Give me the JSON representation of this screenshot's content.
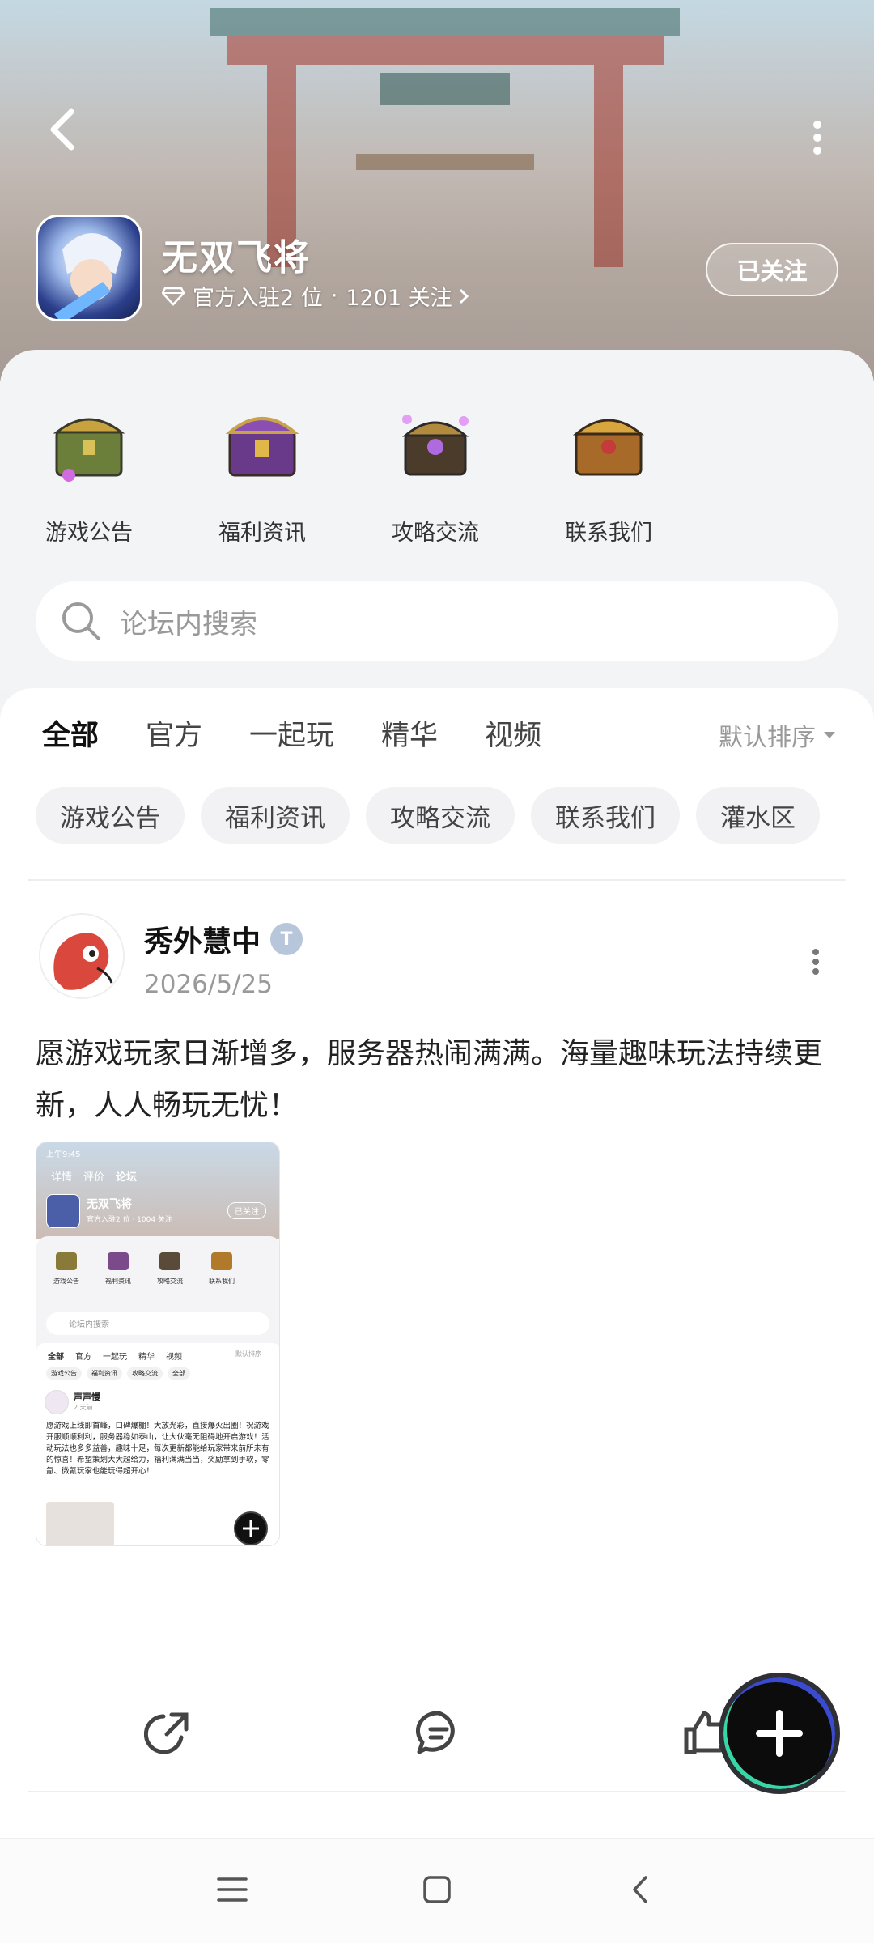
{
  "header": {
    "game_title": "无双飞将",
    "official_text": "官方入驻2 位",
    "separator": "·",
    "followers_text": "1201 关注",
    "follow_label": "已关注"
  },
  "categories": [
    {
      "label": "游戏公告",
      "icon": "green-chest-icon"
    },
    {
      "label": "福利资讯",
      "icon": "purple-chest-icon"
    },
    {
      "label": "攻略交流",
      "icon": "gem-chest-icon"
    },
    {
      "label": "联系我们",
      "icon": "gold-chest-icon"
    }
  ],
  "search": {
    "placeholder": "论坛内搜索"
  },
  "tabs": [
    {
      "label": "全部",
      "active": true
    },
    {
      "label": "官方",
      "active": false
    },
    {
      "label": "一起玩",
      "active": false
    },
    {
      "label": "精华",
      "active": false
    },
    {
      "label": "视频",
      "active": false
    }
  ],
  "sort_label": "默认排序",
  "chips": [
    "游戏公告",
    "福利资讯",
    "攻略交流",
    "联系我们",
    "灌水区"
  ],
  "post": {
    "author": "秀外慧中",
    "date": "2026/5/25",
    "text": "愿游戏玩家日渐增多，服务器热闹满满。海量趣味玩法持续更新，人人畅玩无忧！",
    "thumb": {
      "time": "上午9:45",
      "tabs": [
        "详情",
        "评价",
        "论坛"
      ],
      "title": "无双飞将",
      "sub": "官方入驻2 位 · 1004 关注",
      "follow": "已关注",
      "cats": [
        "游戏公告",
        "福利资讯",
        "攻略交流",
        "联系我们"
      ],
      "search": "论坛内搜索",
      "tabs2": [
        "全部",
        "官方",
        "一起玩",
        "精华",
        "视频"
      ],
      "sort": "默认排序",
      "chips": [
        "游戏公告",
        "福利资讯",
        "攻略交流",
        "全部"
      ],
      "author": "声声慢",
      "time_ago": "2 天前",
      "text": "愿游戏上线即首峰，口碑爆棚！大放光彩，直接爆火出圈！祝游戏开服顺顺利利，服务器稳如泰山，让大伙毫无阻碍地开启游戏！活动玩法也多多益善，趣味十足，每次更新都能给玩家带来前所未有的惊喜！希望策划大大超给力，福利满满当当，奖励拿到手软，零氪、微氪玩家也能玩得超开心！"
    }
  },
  "colors": {
    "accent": "#7ef0c4",
    "fab": "#0c0c0c"
  }
}
